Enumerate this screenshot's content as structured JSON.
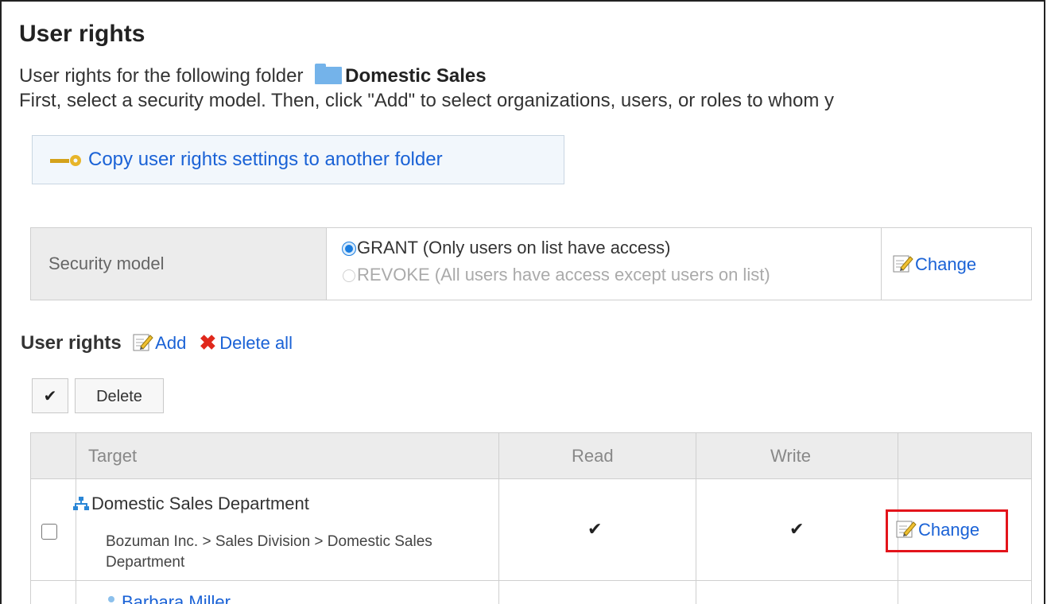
{
  "page": {
    "title": "User rights",
    "folder_prefix": "User rights for the following folder",
    "folder_name": "Domestic Sales",
    "instructions": "First, select a security model. Then, click \"Add\" to select organizations, users, or roles to whom y"
  },
  "copy_button": {
    "label": "Copy user rights settings to another folder"
  },
  "security_model": {
    "label": "Security model",
    "options": [
      {
        "label": "GRANT (Only users on list have access)",
        "selected": true
      },
      {
        "label": "REVOKE (All users have access except users on list)",
        "selected": false
      }
    ],
    "change_label": "Change"
  },
  "user_rights": {
    "heading": "User rights",
    "add_label": "Add",
    "delete_all_label": "Delete all",
    "check_all_glyph": "✔",
    "delete_label": "Delete",
    "columns": [
      "Target",
      "Read",
      "Write"
    ],
    "rows": [
      {
        "name": "Domestic Sales Department",
        "path": "Bozuman Inc. > Sales Division > Domestic Sales Department",
        "read": "✔",
        "write": "✔",
        "change_label": "Change"
      },
      {
        "name": "Barbara Miller"
      }
    ]
  },
  "colors": {
    "link": "#1a62d6",
    "highlight": "#e3141b",
    "delete_x": "#e0281b",
    "folder": "#74b3ea"
  }
}
